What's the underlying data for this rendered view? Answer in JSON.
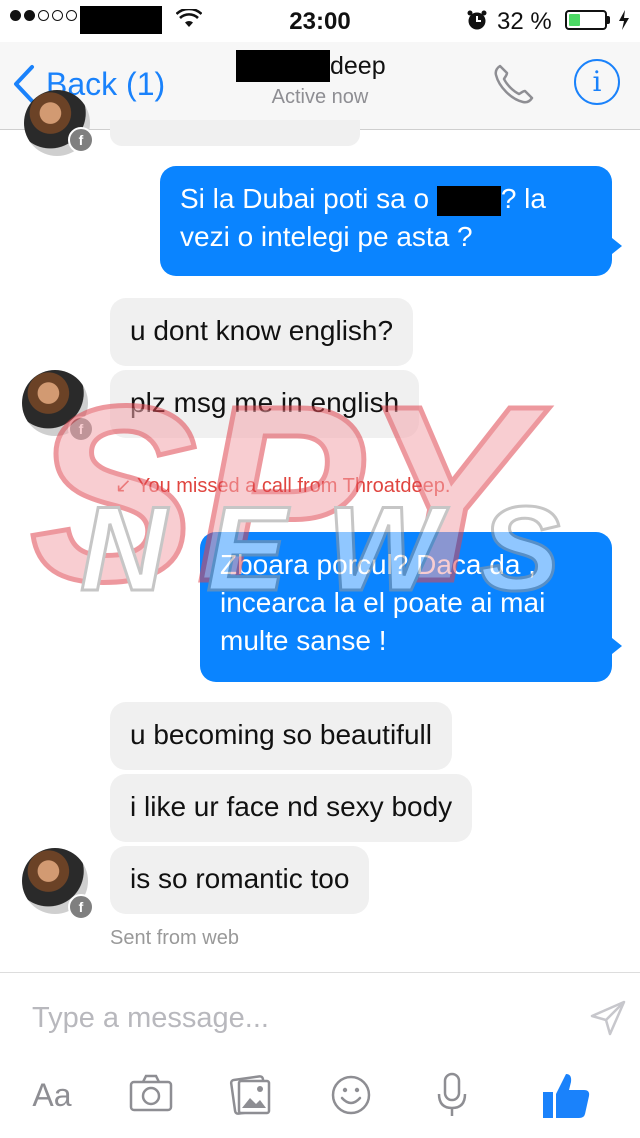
{
  "status_bar": {
    "time": "23:00",
    "battery_percent": "32 %",
    "battery_level": 0.32,
    "colors": {
      "battery": "#4cd964"
    }
  },
  "header": {
    "back_label": "Back (1)",
    "contact_name_visible": "deep",
    "presence": "Active now"
  },
  "messages": {
    "sent_1": "Si la Dubai poti sa o",
    "sent_1_mid": "? la",
    "sent_1_end": "vezi o intelegi pe asta ?",
    "recv_1": "u dont know english?",
    "recv_2": "plz msg me in english",
    "missed_call": "You missed a call from Throatdeep.",
    "sent_2": "Zboara porcul? Daca da , incearca la el poate ai mai multe sanse !",
    "recv_3": "u becoming so beautifull",
    "recv_4": "i like ur face nd sexy body",
    "recv_5": "is so romantic too",
    "sent_from": "Sent from web"
  },
  "watermark": {
    "line1": "SPY",
    "line2": "NEWS"
  },
  "composer": {
    "placeholder": "Type a message...",
    "text_format_label": "Aa"
  },
  "icons": [
    "phone-icon",
    "info-icon",
    "back-chevron-icon",
    "send-icon",
    "camera-icon",
    "photo-icon",
    "emoji-icon",
    "microphone-icon",
    "like-icon",
    "facebook-badge-icon"
  ],
  "colors": {
    "accent": "#1a82fb",
    "outgoing_bubble": "#0a84ff",
    "incoming_bubble": "#f0f0f0",
    "missed_call": "#e0453f"
  }
}
